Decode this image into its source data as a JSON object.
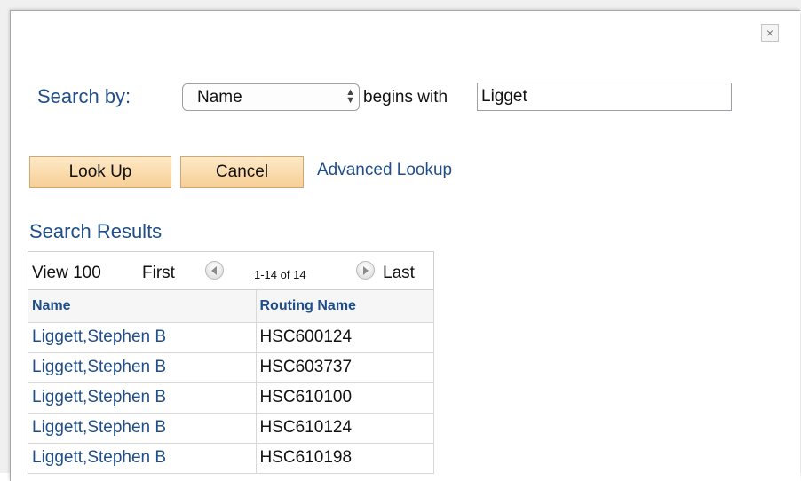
{
  "dialog": {
    "close_symbol": "×",
    "close_icon": "close-icon"
  },
  "search": {
    "label": "Search by:",
    "field_selected": "Name",
    "operator": "begins with",
    "value": "Ligget"
  },
  "buttons": {
    "lookup": "Look Up",
    "cancel": "Cancel",
    "advanced": "Advanced Lookup"
  },
  "results": {
    "title": "Search Results",
    "nav": {
      "view": "View 100",
      "first": "First",
      "count": "1-14 of 14",
      "last": "Last",
      "prev_icon": "previous-arrow-icon",
      "next_icon": "next-arrow-icon"
    },
    "columns": [
      "Name",
      "Routing Name"
    ],
    "rows": [
      [
        "Liggett,Stephen B",
        "HSC600124"
      ],
      [
        "Liggett,Stephen B",
        "HSC603737"
      ],
      [
        "Liggett,Stephen B",
        "HSC610100"
      ],
      [
        "Liggett,Stephen B",
        "HSC610124"
      ],
      [
        "Liggett,Stephen B",
        "HSC610198"
      ]
    ]
  },
  "colors": {
    "link_blue": "#1f4e8a",
    "button_fill": "#f7cf95",
    "button_border": "#d0a673"
  }
}
